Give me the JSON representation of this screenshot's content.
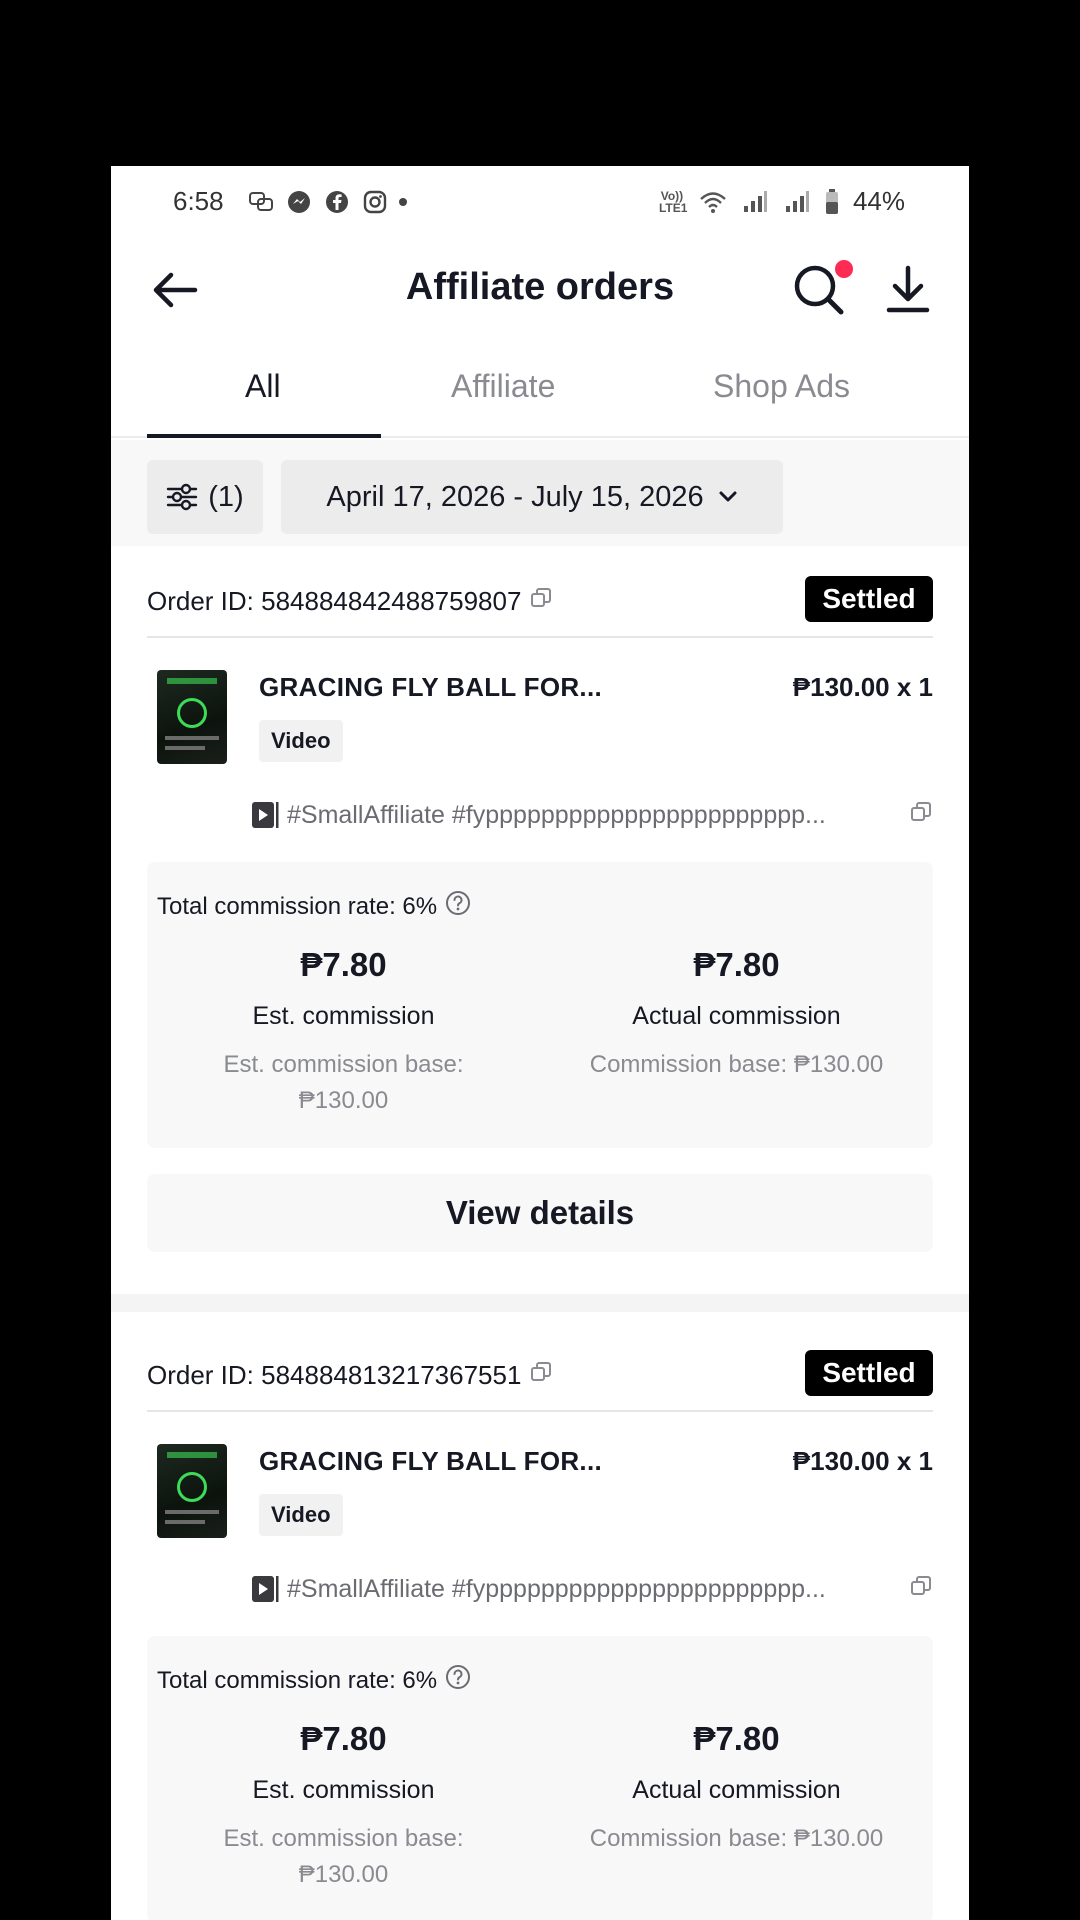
{
  "status_bar": {
    "time": "6:58",
    "battery": "44%",
    "signal_label": "Vo)) LTE1"
  },
  "header": {
    "title": "Affiliate orders"
  },
  "tabs": [
    {
      "label": "All",
      "active": true
    },
    {
      "label": "Affiliate",
      "active": false
    },
    {
      "label": "Shop Ads",
      "active": false
    }
  ],
  "filters": {
    "filter_count": "(1)",
    "date_range": "April 17, 2026 - July 15, 2026"
  },
  "orders": [
    {
      "order_id": "Order ID: 584884842488759807",
      "status": "Settled",
      "product_name": "GRACING FLY BALL FOR...",
      "price_qty": "₱130.00 x 1",
      "content_type": "Video",
      "video_caption": "#SmallAffiliate #fyppppppppppppppppppppppp...",
      "commission_rate": "Total commission rate: 6%",
      "est_commission": "₱7.80",
      "est_label": "Est. commission",
      "est_base_line1": "Est. commission base:",
      "est_base_line2": "₱130.00",
      "actual_commission": "₱7.80",
      "actual_label": "Actual commission",
      "actual_base": "Commission base: ₱130.00",
      "view_details": "View details"
    },
    {
      "order_id": "Order ID: 584884813217367551",
      "status": "Settled",
      "product_name": "GRACING FLY BALL FOR...",
      "price_qty": "₱130.00 x 1",
      "content_type": "Video",
      "video_caption": "#SmallAffiliate #fyppppppppppppppppppppppp...",
      "commission_rate": "Total commission rate: 6%",
      "est_commission": "₱7.80",
      "est_label": "Est. commission",
      "est_base_line1": "Est. commission base:",
      "est_base_line2": "₱130.00",
      "actual_commission": "₱7.80",
      "actual_label": "Actual commission",
      "actual_base": "Commission base: ₱130.00"
    }
  ],
  "colors": {
    "accent_dot": "#fe2c55",
    "badge_bg": "#000000",
    "muted_text": "#8a8b91"
  }
}
